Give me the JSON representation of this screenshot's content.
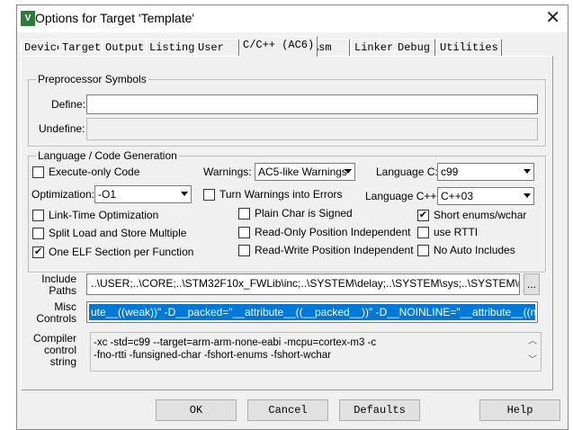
{
  "title": "Options for Target 'Template'",
  "tabs": [
    "Device",
    "Target",
    "Output",
    "Listing",
    "User",
    "C/C++ (AC6)",
    "Asm",
    "Linker",
    "Debug",
    "Utilities"
  ],
  "preprocessor": {
    "group": "Preprocessor Symbols",
    "define_label": "Define:",
    "define_value": "",
    "undefine_label": "Undefine:",
    "undefine_value": ""
  },
  "language": {
    "group": "Language / Code Generation",
    "execute_only": "Execute-only Code",
    "warnings_label": "Warnings:",
    "warnings_value": "AC5-like Warnings",
    "lang_c_label": "Language C:",
    "lang_c_value": "c99",
    "optimization_label": "Optimization:",
    "optimization_value": "-O1",
    "turn_warnings": "Turn Warnings into Errors",
    "lang_cpp_label": "Language C++:",
    "lang_cpp_value": "C++03",
    "lto": "Link-Time Optimization",
    "plain_char": "Plain Char is Signed",
    "short_enums": "Short enums/wchar",
    "split_load": "Split Load and Store Multiple",
    "ro_pi": "Read-Only Position Independent",
    "rtti": "use RTTI",
    "one_elf": "One ELF Section per Function",
    "rw_pi": "Read-Write Position Independent",
    "no_auto": "No Auto Includes",
    "checks": {
      "execute_only": false,
      "turn_warnings": false,
      "lto": false,
      "plain_char": false,
      "short_enums": true,
      "split_load": false,
      "ro_pi": false,
      "rtti": false,
      "one_elf": true,
      "rw_pi": false,
      "no_auto": false
    }
  },
  "include": {
    "label1": "Include",
    "label2": "Paths",
    "value": "..\\USER;..\\CORE;..\\STM32F10x_FWLib\\inc;..\\SYSTEM\\delay;..\\SYSTEM\\sys;..\\SYSTEM\\usart",
    "browse": "..."
  },
  "misc": {
    "label1": "Misc",
    "label2": "Controls",
    "value": "ute__((weak))\" -D__packed=\"__attribute__((__packed__))\" -D__NOINLINE=\"__attribute__((noinline))\""
  },
  "compiler": {
    "label1": "Compiler",
    "label2": "control",
    "label3": "string",
    "line1": "-xc -std=c99 --target=arm-arm-none-eabi -mcpu=cortex-m3 -c",
    "line2": "-fno-rtti -funsigned-char -fshort-enums -fshort-wchar"
  },
  "buttons": {
    "ok": "OK",
    "cancel": "Cancel",
    "defaults": "Defaults",
    "help": "Help"
  }
}
